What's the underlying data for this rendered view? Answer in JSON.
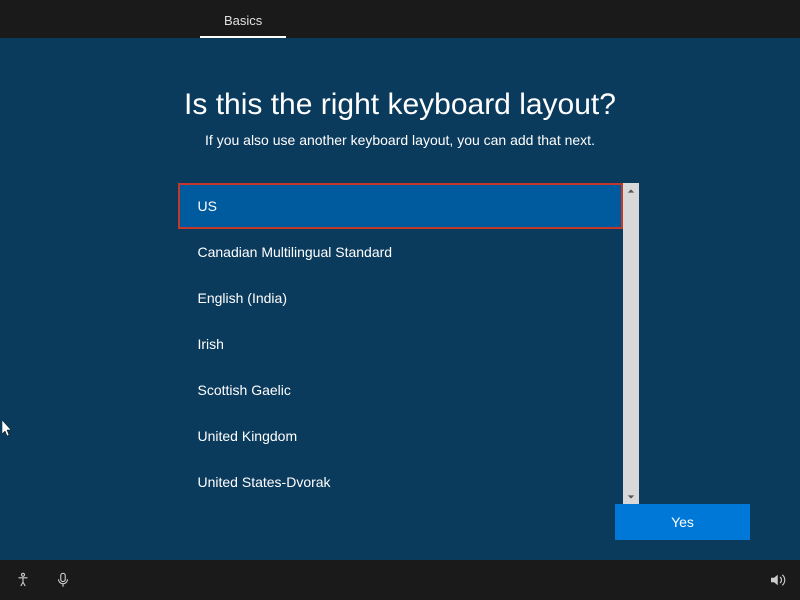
{
  "tabs": {
    "active": "Basics"
  },
  "heading": "Is this the right keyboard layout?",
  "subheading": "If you also use another keyboard layout, you can add that next.",
  "layouts": [
    "US",
    "Canadian Multilingual Standard",
    "English (India)",
    "Irish",
    "Scottish Gaelic",
    "United Kingdom",
    "United States-Dvorak"
  ],
  "selected_index": 0,
  "buttons": {
    "yes": "Yes"
  }
}
